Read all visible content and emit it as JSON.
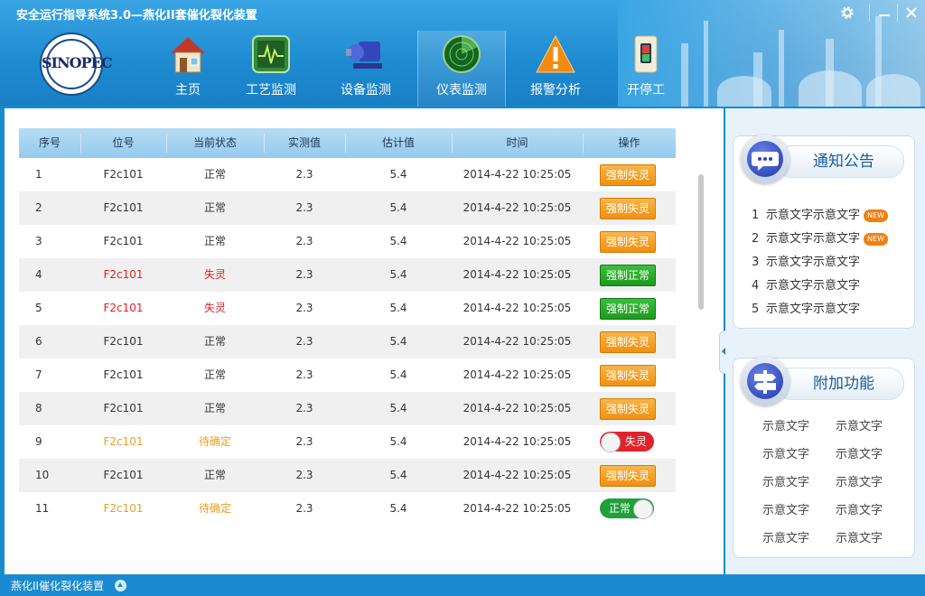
{
  "window": {
    "title": "安全运行指导系统3.0—燕化II套催化裂化装置"
  },
  "logo": {
    "text": "SINOPEC"
  },
  "nav": [
    {
      "label": "主页",
      "icon": "home-icon"
    },
    {
      "label": "工艺监测",
      "icon": "monitor-waveform-icon"
    },
    {
      "label": "设备监测",
      "icon": "pump-icon"
    },
    {
      "label": "仪表监测",
      "icon": "radar-icon",
      "active": true
    },
    {
      "label": "报警分析",
      "icon": "warning-icon"
    },
    {
      "label": "开停工",
      "icon": "switch-icon"
    }
  ],
  "table": {
    "headers": [
      "序号",
      "位号",
      "当前状态",
      "实测值",
      "估计值",
      "时间",
      "操作"
    ],
    "rows": [
      {
        "no": "1",
        "tag": "F2c101",
        "status": "正常",
        "measured": "2.3",
        "estimated": "5.4",
        "time": "2014-4-22  10:25:05",
        "action": "强制失灵",
        "action_type": "orange-button",
        "color": "normal"
      },
      {
        "no": "2",
        "tag": "F2c101",
        "status": "正常",
        "measured": "2.3",
        "estimated": "5.4",
        "time": "2014-4-22  10:25:05",
        "action": "强制失灵",
        "action_type": "orange-button",
        "color": "normal"
      },
      {
        "no": "3",
        "tag": "F2c101",
        "status": "正常",
        "measured": "2.3",
        "estimated": "5.4",
        "time": "2014-4-22  10:25:05",
        "action": "强制失灵",
        "action_type": "orange-button",
        "color": "normal"
      },
      {
        "no": "4",
        "tag": "F2c101",
        "status": "失灵",
        "measured": "2.3",
        "estimated": "5.4",
        "time": "2014-4-22  10:25:05",
        "action": "强制正常",
        "action_type": "green-button",
        "color": "red"
      },
      {
        "no": "5",
        "tag": "F2c101",
        "status": "失灵",
        "measured": "2.3",
        "estimated": "5.4",
        "time": "2014-4-22  10:25:05",
        "action": "强制正常",
        "action_type": "green-button",
        "color": "red"
      },
      {
        "no": "6",
        "tag": "F2c101",
        "status": "正常",
        "measured": "2.3",
        "estimated": "5.4",
        "time": "2014-4-22  10:25:05",
        "action": "强制失灵",
        "action_type": "orange-button",
        "color": "normal"
      },
      {
        "no": "7",
        "tag": "F2c101",
        "status": "正常",
        "measured": "2.3",
        "estimated": "5.4",
        "time": "2014-4-22  10:25:05",
        "action": "强制失灵",
        "action_type": "orange-button",
        "color": "normal"
      },
      {
        "no": "8",
        "tag": "F2c101",
        "status": "正常",
        "measured": "2.3",
        "estimated": "5.4",
        "time": "2014-4-22  10:25:05",
        "action": "强制失灵",
        "action_type": "orange-button",
        "color": "normal"
      },
      {
        "no": "9",
        "tag": "F2c101",
        "status": "待确定",
        "measured": "2.3",
        "estimated": "5.4",
        "time": "2014-4-22  10:25:05",
        "action": "失灵",
        "action_type": "red-toggle",
        "color": "orange"
      },
      {
        "no": "10",
        "tag": "F2c101",
        "status": "正常",
        "measured": "2.3",
        "estimated": "5.4",
        "time": "2014-4-22  10:25:05",
        "action": "强制失灵",
        "action_type": "orange-button",
        "color": "normal"
      },
      {
        "no": "11",
        "tag": "F2c101",
        "status": "待确定",
        "measured": "2.3",
        "estimated": "5.4",
        "time": "2014-4-22  10:25:05",
        "action": "正常",
        "action_type": "green-toggle",
        "color": "orange"
      }
    ]
  },
  "notice": {
    "title": "通知公告",
    "icon": "chat-bubble-icon",
    "items": [
      {
        "num": "1",
        "text": "示意文字示意文字",
        "badge": "NEW"
      },
      {
        "num": "2",
        "text": "示意文字示意文字",
        "badge": "NEW"
      },
      {
        "num": "3",
        "text": "示意文字示意文字",
        "badge": null
      },
      {
        "num": "4",
        "text": "示意文字示意文字",
        "badge": null
      },
      {
        "num": "5",
        "text": "示意文字示意文字",
        "badge": null
      }
    ]
  },
  "extra": {
    "title": "附加功能",
    "icon": "signpost-icon",
    "items": [
      "示意文字",
      "示意文字",
      "示意文字",
      "示意文字",
      "示意文字",
      "示意文字",
      "示意文字",
      "示意文字",
      "示意文字",
      "示意文字"
    ]
  },
  "statusbar": {
    "text": "燕化II催化裂化装置",
    "icon": "expand-up-icon"
  },
  "colors": {
    "accent": "#1a8ad0",
    "header_row": "#a8d4f2",
    "orange_button": "#f09010",
    "green_button": "#1c9a1c",
    "red_text": "#e02020",
    "pending_text": "#e8a020"
  }
}
